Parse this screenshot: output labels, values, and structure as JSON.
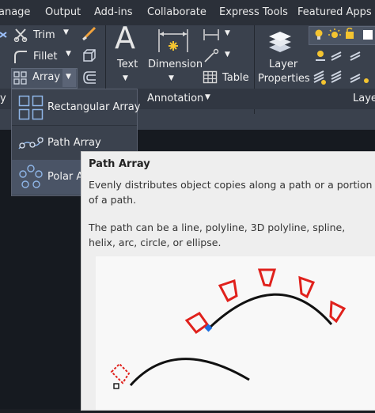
{
  "tabs": [
    "anage",
    "Output",
    "Add-ins",
    "Collaborate",
    "Express Tools",
    "Featured Apps"
  ],
  "modify_panel": {
    "trim_label": "Trim",
    "fillet_label": "Fillet",
    "array_label": "Array",
    "array_menu": [
      {
        "label": "Rectangular Array",
        "icon": "rectangular-array-icon"
      },
      {
        "label": "Path Array",
        "icon": "path-array-icon"
      },
      {
        "label": "Polar Array",
        "icon": "polar-array-icon"
      }
    ]
  },
  "annotation_panel": {
    "text_label": "Text",
    "dimension_label": "Dimension",
    "table_label": "Table",
    "title": "Annotation"
  },
  "layers_panel": {
    "layer_properties_label_1": "Layer",
    "layer_properties_label_2": "Properties",
    "title": "Laye"
  },
  "left_panel_fragment": "y",
  "tooltip": {
    "title": "Path Array",
    "description": "Evenly distributes object copies along a path or a portion of a path.",
    "note": "The path can be a line, polyline, 3D polyline, spline, helix, arc, circle, or ellipse."
  },
  "colors": {
    "ribbon_bg": "#3a414d",
    "tabbar_bg": "#2b3039",
    "canvas_bg": "#161a20",
    "tooltip_bg": "#eeeeee",
    "accent_red": "#e0211c",
    "accent_blue": "#1e6fe0"
  }
}
